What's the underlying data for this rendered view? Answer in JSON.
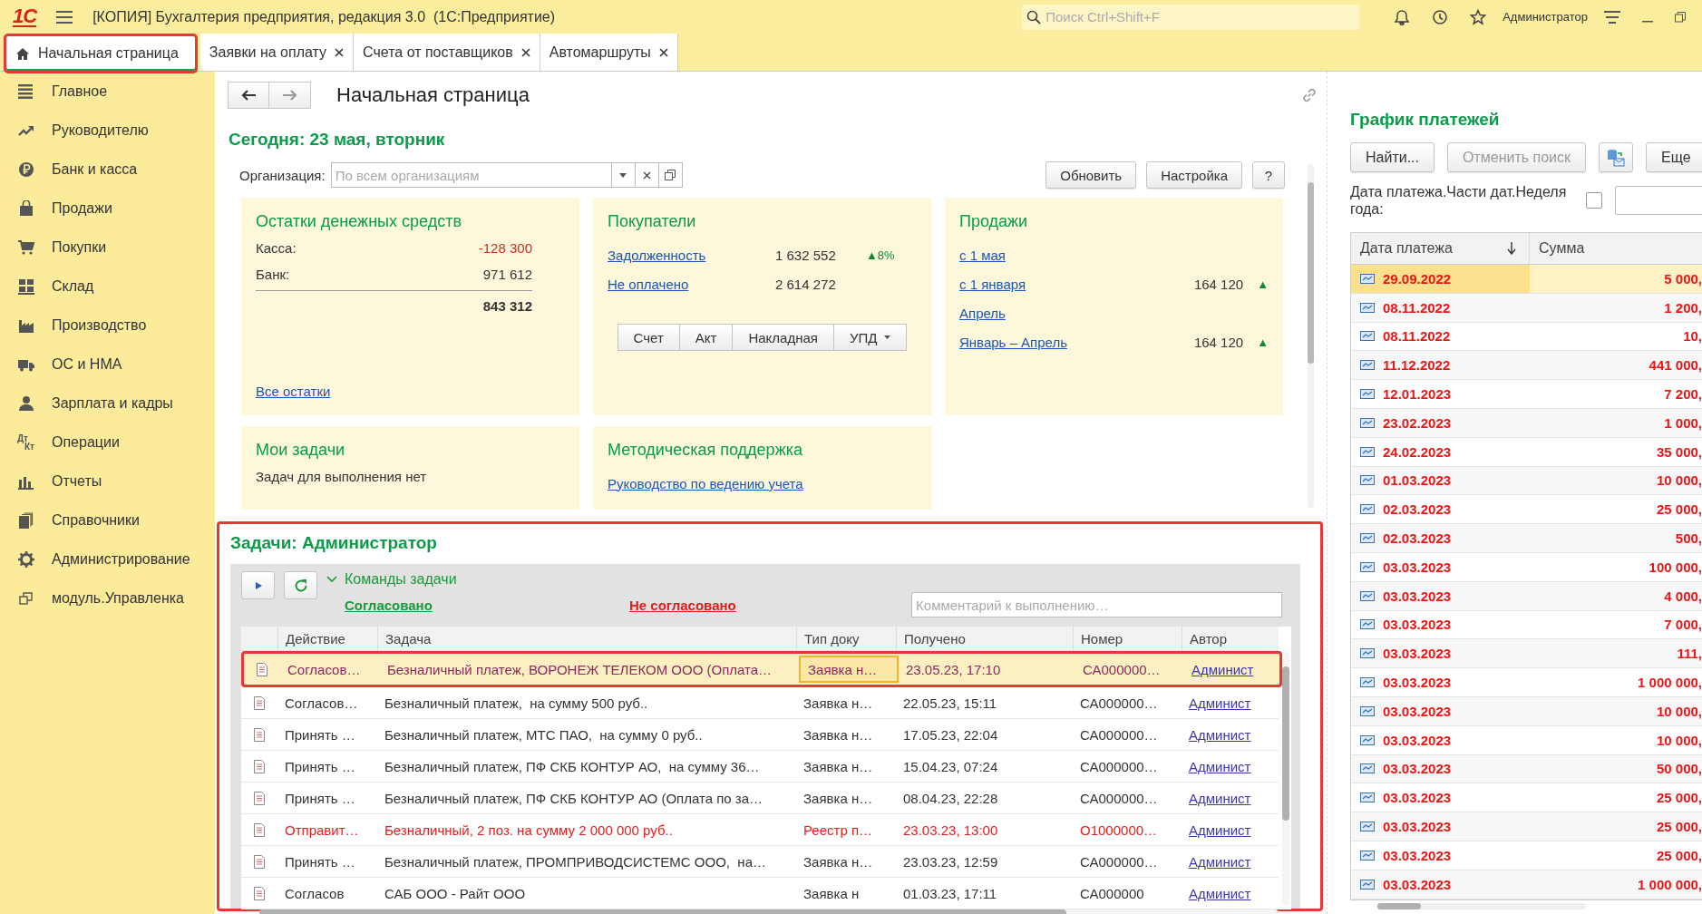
{
  "window": {
    "logo": "1С",
    "title": "[КОПИЯ] Бухгалтерия предприятия, редакция 3.0  (1С:Предприятие)",
    "search": {
      "placeholder": "Поиск Ctrl+Shift+F"
    },
    "user": "Администратор"
  },
  "tabs": [
    {
      "label": "Начальная страница",
      "selected": true,
      "home": true,
      "closable": false,
      "highlighted": true
    },
    {
      "label": "Заявки на оплату",
      "selected": false,
      "home": false,
      "closable": true,
      "highlighted": false
    },
    {
      "label": "Счета от поставщиков",
      "selected": false,
      "home": false,
      "closable": true,
      "highlighted": false
    },
    {
      "label": "Автомаршруты",
      "selected": false,
      "home": false,
      "closable": true,
      "highlighted": false
    }
  ],
  "sidebar": {
    "items": [
      {
        "label": "Главное"
      },
      {
        "label": "Руководителю"
      },
      {
        "label": "Банк и касса"
      },
      {
        "label": "Продажи"
      },
      {
        "label": "Покупки"
      },
      {
        "label": "Склад"
      },
      {
        "label": "Производство"
      },
      {
        "label": "ОС и НМА"
      },
      {
        "label": "Зарплата и кадры"
      },
      {
        "label": "Операции",
        "icon_text": [
          "Дт",
          "Кт"
        ]
      },
      {
        "label": "Отчеты"
      },
      {
        "label": "Справочники"
      },
      {
        "label": "Администрирование"
      },
      {
        "label": "модуль.Управленка"
      }
    ]
  },
  "page": {
    "title": "Начальная страница",
    "today": "Сегодня: 23 мая, вторник",
    "organization": {
      "label": "Организация:",
      "placeholder": "По всем организациям"
    },
    "buttons": [
      "Обновить",
      "Настройка",
      "?"
    ],
    "cards": [
      {
        "kind": "balances",
        "title": "Остатки денежных средств",
        "rows": [
          {
            "label": "Касса:",
            "value": "-128 300",
            "negative": true
          },
          {
            "label": "Банк:",
            "value": "971 612",
            "negative": false
          }
        ],
        "total": "843 312",
        "link": "Все остатки"
      },
      {
        "kind": "links",
        "title": "Покупатели",
        "rows": [
          {
            "link": "Задолженность",
            "value": "1 632 552",
            "trend": "▲8%"
          },
          {
            "link": "Не оплачено",
            "value": "2 614 272"
          }
        ],
        "doc_buttons": [
          "Счет",
          "Акт",
          "Накладная",
          "УПД"
        ]
      },
      {
        "kind": "links",
        "title": "Продажи",
        "rows": [
          {
            "link": "с 1 мая"
          },
          {
            "link": "с 1 января",
            "value": "164 120",
            "trend": "▲"
          },
          {
            "link": "Апрель"
          },
          {
            "link": "Январь – Апрель",
            "value": "164 120",
            "trend": "▲"
          }
        ]
      },
      {
        "kind": "text",
        "title": "Мои задачи",
        "text": "Задач для выполнения нет"
      },
      {
        "kind": "links",
        "title": "Методическая поддержка",
        "rows": [
          {
            "link": "Руководство по ведению учета"
          }
        ]
      }
    ]
  },
  "tasks": {
    "title": "Задачи: Администратор",
    "highlighted": true,
    "commands_label": "Команды задачи",
    "expanded": true,
    "actions": [
      {
        "label": "Согласовано",
        "kind": "approve"
      },
      {
        "label": "Не согласовано",
        "kind": "reject"
      }
    ],
    "comment": {
      "placeholder": "Комментарий к выполнению…"
    },
    "columns": [
      {
        "label": "Действие",
        "link": false
      },
      {
        "label": "Задача",
        "link": false
      },
      {
        "label": "Тип доку",
        "link": false
      },
      {
        "label": "Получено",
        "link": false
      },
      {
        "label": "Номер",
        "link": false
      },
      {
        "label": "Автор",
        "link": true
      }
    ],
    "rows": [
      {
        "selected": true,
        "highlighted": true,
        "overdue": false,
        "doc_type_focused": true,
        "cells": [
          "Согласов…",
          "Безналичный платеж, ВОРОНЕЖ ТЕЛЕКОМ ООО (Оплата…",
          "Заявка н…",
          "23.05.23, 17:10",
          "СА000000…",
          "Админист"
        ]
      },
      {
        "selected": false,
        "highlighted": false,
        "overdue": false,
        "cells": [
          "Согласов…",
          "Безналичный платеж,  на сумму 500 руб..",
          "Заявка н…",
          "22.05.23, 15:11",
          "СА000000…",
          "Админист"
        ]
      },
      {
        "selected": false,
        "highlighted": false,
        "overdue": false,
        "cells": [
          "Принять …",
          "Безналичный платеж, МТС ПАО,  на сумму 0 руб..",
          "Заявка н…",
          "17.05.23, 22:04",
          "СА000000…",
          "Админист"
        ]
      },
      {
        "selected": false,
        "highlighted": false,
        "overdue": false,
        "cells": [
          "Принять …",
          "Безналичный платеж, ПФ СКБ КОНТУР АО,  на сумму 36…",
          "Заявка н…",
          "15.04.23, 07:24",
          "СА000000…",
          "Админист"
        ]
      },
      {
        "selected": false,
        "highlighted": false,
        "overdue": false,
        "cells": [
          "Принять …",
          "Безналичный платеж, ПФ СКБ КОНТУР АО (Оплата по за…",
          "Заявка н…",
          "08.04.23, 22:28",
          "СА000000…",
          "Админист"
        ]
      },
      {
        "selected": false,
        "highlighted": false,
        "overdue": true,
        "cells": [
          "Отправит…",
          "Безналичный, 2 поз. на сумму 2 000 000 руб..",
          "Реестр п…",
          "23.03.23, 13:00",
          "О1000000…",
          "Админист"
        ]
      },
      {
        "selected": false,
        "highlighted": false,
        "overdue": false,
        "cells": [
          "Принять …",
          "Безналичный платеж, ПРОМПРИВОДСИСТЕМС ООО,  на…",
          "Заявка н…",
          "23.03.23, 12:59",
          "СА000000…",
          "Админист"
        ]
      },
      {
        "selected": false,
        "highlighted": false,
        "overdue": false,
        "cells": [
          "Согласов",
          "САБ ООО - Райт ООО",
          "Заявка н",
          "01.03.23, 17:11",
          "СА000000",
          "Админист"
        ]
      }
    ]
  },
  "schedule": {
    "title": "График платежей",
    "buttons": [
      {
        "label": "Найти...",
        "disabled": false
      },
      {
        "label": "Отменить поиск",
        "disabled": true
      }
    ],
    "more": "Еще",
    "filter": {
      "label": "Дата платежа.Части дат.Неделя года:",
      "checked": false
    },
    "columns": [
      "Дата платежа",
      "Сумма"
    ],
    "rows": [
      {
        "date": "29.09.2022",
        "sum": "5 000,",
        "selected": true
      },
      {
        "date": "08.11.2022",
        "sum": "1 200,",
        "selected": false
      },
      {
        "date": "08.11.2022",
        "sum": "10,",
        "selected": false
      },
      {
        "date": "11.12.2022",
        "sum": "441 000,",
        "selected": false
      },
      {
        "date": "12.01.2023",
        "sum": "7 200,",
        "selected": false
      },
      {
        "date": "23.02.2023",
        "sum": "1 000,",
        "selected": false
      },
      {
        "date": "24.02.2023",
        "sum": "35 000,",
        "selected": false
      },
      {
        "date": "01.03.2023",
        "sum": "10 000,",
        "selected": false
      },
      {
        "date": "02.03.2023",
        "sum": "25 000,",
        "selected": false
      },
      {
        "date": "02.03.2023",
        "sum": "500,",
        "selected": false
      },
      {
        "date": "03.03.2023",
        "sum": "100 000,",
        "selected": false
      },
      {
        "date": "03.03.2023",
        "sum": "4 000,",
        "selected": false
      },
      {
        "date": "03.03.2023",
        "sum": "7 000,",
        "selected": false
      },
      {
        "date": "03.03.2023",
        "sum": "111,",
        "selected": false
      },
      {
        "date": "03.03.2023",
        "sum": "1 000 000,",
        "selected": false
      },
      {
        "date": "03.03.2023",
        "sum": "10 000,",
        "selected": false
      },
      {
        "date": "03.03.2023",
        "sum": "10 000,",
        "selected": false
      },
      {
        "date": "03.03.2023",
        "sum": "50 000,",
        "selected": false
      },
      {
        "date": "03.03.2023",
        "sum": "25 000,",
        "selected": false
      },
      {
        "date": "03.03.2023",
        "sum": "25 000,",
        "selected": false
      },
      {
        "date": "03.03.2023",
        "sum": "25 000,",
        "selected": false
      },
      {
        "date": "03.03.2023",
        "sum": "1 000 000,",
        "selected": false
      }
    ]
  }
}
